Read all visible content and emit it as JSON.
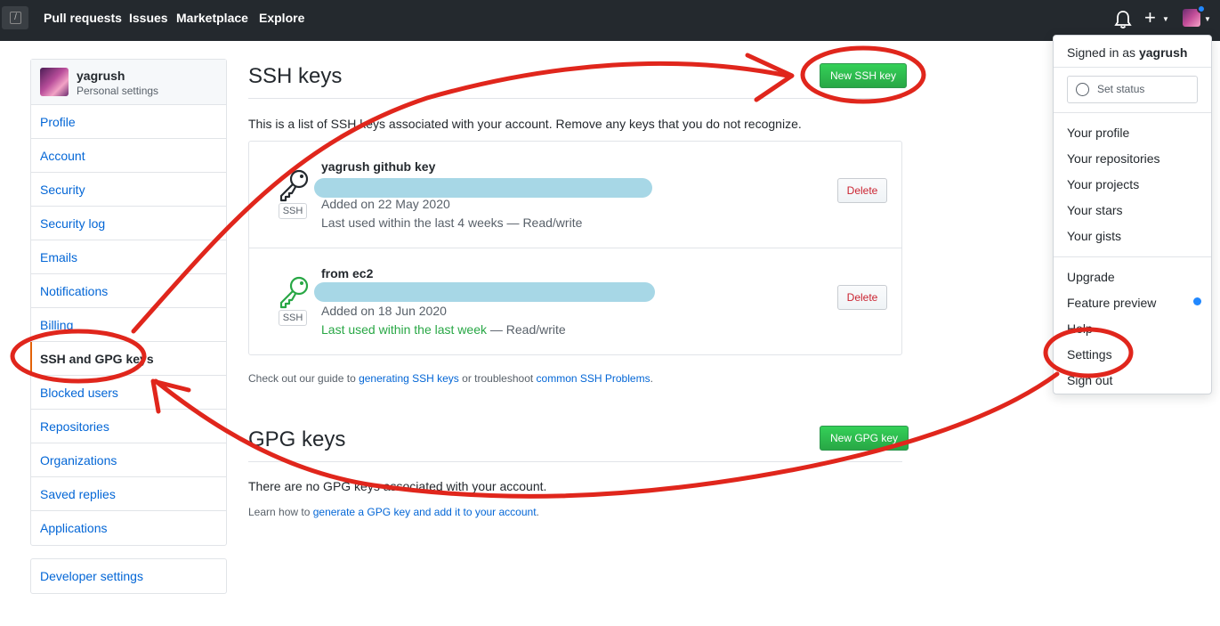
{
  "header": {
    "nav": [
      "Pull requests",
      "Issues",
      "Marketplace",
      "Explore"
    ],
    "logo_glyph": "/",
    "plus_glyph": "+",
    "icons": {
      "bell": "bell-icon",
      "plus": "plus-icon",
      "avatar": "user-avatar"
    }
  },
  "sidebar": {
    "username": "yagrush",
    "subtitle": "Personal settings",
    "items": [
      {
        "label": "Profile"
      },
      {
        "label": "Account"
      },
      {
        "label": "Security"
      },
      {
        "label": "Security log"
      },
      {
        "label": "Emails"
      },
      {
        "label": "Notifications"
      },
      {
        "label": "Billing"
      },
      {
        "label": "SSH and GPG keys",
        "selected": true
      },
      {
        "label": "Blocked users"
      },
      {
        "label": "Repositories"
      },
      {
        "label": "Organizations"
      },
      {
        "label": "Saved replies"
      },
      {
        "label": "Applications"
      }
    ],
    "developer_settings": "Developer settings"
  },
  "ssh": {
    "title": "SSH keys",
    "new_button": "New SSH key",
    "description": "This is a list of SSH keys associated with your account. Remove any keys that you do not recognize.",
    "keys": [
      {
        "name": "yagrush github key",
        "added": "Added on 22 May 2020",
        "used_prefix": "Last used within the last 4 weeks",
        "used_suffix": " — Read/write",
        "badge": "SSH",
        "delete": "Delete",
        "recent": false
      },
      {
        "name": "from ec2",
        "added": "Added on 18 Jun 2020",
        "used_prefix": "Last used within the last week",
        "used_suffix": " — Read/write",
        "badge": "SSH",
        "delete": "Delete",
        "recent": true
      }
    ],
    "guide_prefix": "Check out our guide to ",
    "guide_link1": "generating SSH keys",
    "guide_mid": " or troubleshoot ",
    "guide_link2": "common SSH Problems",
    "guide_suffix": "."
  },
  "gpg": {
    "title": "GPG keys",
    "new_button": "New GPG key",
    "empty": "There are no GPG keys associated with your account.",
    "learn_prefix": "Learn how to ",
    "learn_link": "generate a GPG key and add it to your account",
    "learn_suffix": "."
  },
  "dropdown": {
    "signed_in_prefix": "Signed in as ",
    "signed_in_user": "yagrush",
    "set_status": "Set status",
    "items_group1": [
      "Your profile",
      "Your repositories",
      "Your projects",
      "Your stars",
      "Your gists"
    ],
    "items_group2": [
      "Upgrade",
      "Feature preview",
      "Help",
      "Settings",
      "Sign out"
    ]
  },
  "colors": {
    "header_bg": "#24292e",
    "link": "#0366d6",
    "green_button": "#28a745",
    "delete_red": "#cb2431",
    "annotation_red": "#e0261c",
    "fingerprint_mask": "#a7d7e6",
    "selected_border": "#e36209"
  }
}
